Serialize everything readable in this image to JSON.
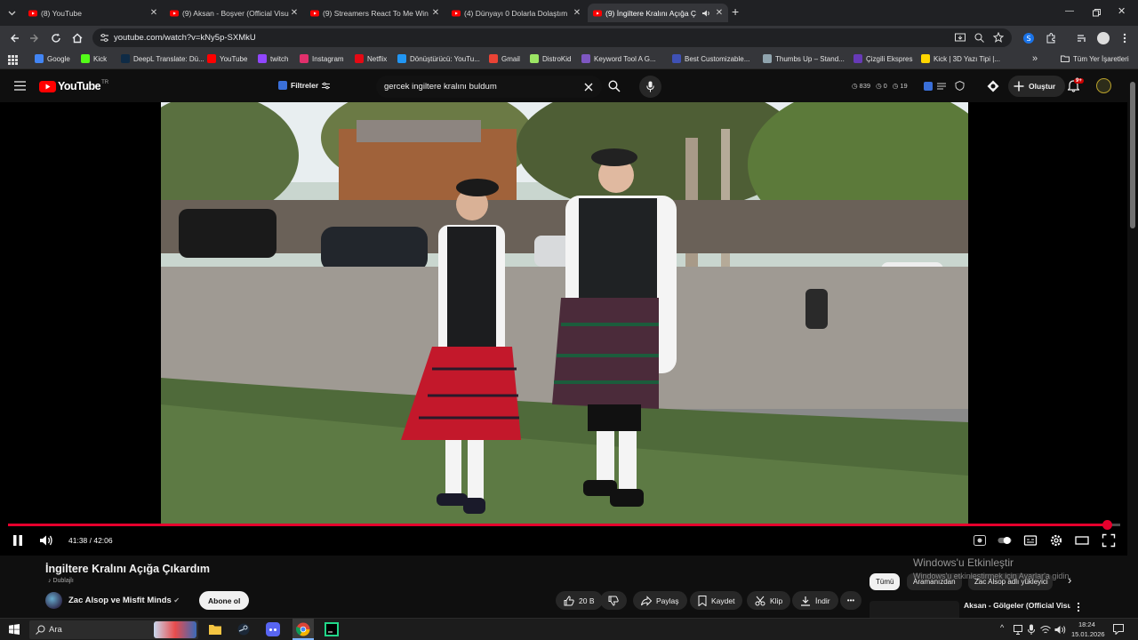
{
  "browser": {
    "tabs": [
      {
        "title": "(8) YouTube",
        "active": false
      },
      {
        "title": "(9) Aksan - Boşver (Official Visu",
        "active": false
      },
      {
        "title": "(9) Streamers React To Me Win",
        "active": false
      },
      {
        "title": "(4) Dünyayı 0 Dolarla Dolaştım",
        "active": false
      },
      {
        "title": "(9) İngiltere Kralını Açığa Ç",
        "active": true
      }
    ],
    "new_tab": "+",
    "url": "youtube.com/watch?v=kNy5p-SXMkU",
    "bookmarks": [
      {
        "label": "Google",
        "color": "#4285f4"
      },
      {
        "label": "Kick",
        "color": "#53fc18"
      },
      {
        "label": "DeepL Translate: Dü...",
        "color": "#0f2b46"
      },
      {
        "label": "YouTube",
        "color": "#ff0000"
      },
      {
        "label": "twitch",
        "color": "#9146ff"
      },
      {
        "label": "Instagram",
        "color": "#e1306c"
      },
      {
        "label": "Netflix",
        "color": "#e50914"
      },
      {
        "label": "Dönüştürücü: YouTu...",
        "color": "#2196f3"
      },
      {
        "label": "Gmail",
        "color": "#ea4335"
      },
      {
        "label": "DistroKid",
        "color": "#9be564"
      },
      {
        "label": "Keyword Tool A G...",
        "color": "#7e57c2"
      },
      {
        "label": "Best Customizable...",
        "color": "#3f51b5"
      },
      {
        "label": "Thumbs Up – Stand...",
        "color": "#90a4ae"
      },
      {
        "label": "Çizgili Ekspres",
        "color": "#673ab7"
      },
      {
        "label": "Kick | 3D Yazı Tipi |...",
        "color": "#ffd600"
      }
    ],
    "more_bookmarks": "»",
    "all_bookmarks": "Tüm Yer İşaretleri"
  },
  "youtube": {
    "logo_text": "YouTube",
    "region": "TR",
    "filters_label": "Filtreler",
    "search_query": "gercek ingiltere kralını buldum",
    "stats": {
      "views": "839",
      "likes": "0",
      "other": "19"
    },
    "create_label": "Oluştur",
    "notification_badge": "9+"
  },
  "player": {
    "current_time": "41:38",
    "duration": "42:06",
    "time_display": "41:38 / 42:06",
    "progress_fraction": 0.989,
    "accent": "#e6002d"
  },
  "video": {
    "title": "İngiltere Kralını Açığa Çıkardım",
    "dubbed_label": "Dublajlı",
    "channel": "Zac Alsop ve Misfit Minds",
    "subscribe_label": "Abone ol",
    "likes": "20 B",
    "share_label": "Paylaş",
    "save_label": "Kaydet",
    "clip_label": "Klip",
    "download_label": "İndir",
    "more": "•••"
  },
  "sidebar_filters": {
    "chips": [
      "Tümü",
      "Aramanızdan",
      "Zac Alsop adlı yükleyici"
    ],
    "next": "›"
  },
  "recommendation": {
    "title": "Aksan - Gölgeler (Official Visualizer)"
  },
  "windows_watermark": {
    "line1": "Windows'u Etkinleştir",
    "line2": "Windows'u etkinleştirmek için Ayarlar'a gidin."
  },
  "taskbar": {
    "search_placeholder": "Ara",
    "time": "18:24",
    "date": "15.01.2026"
  }
}
